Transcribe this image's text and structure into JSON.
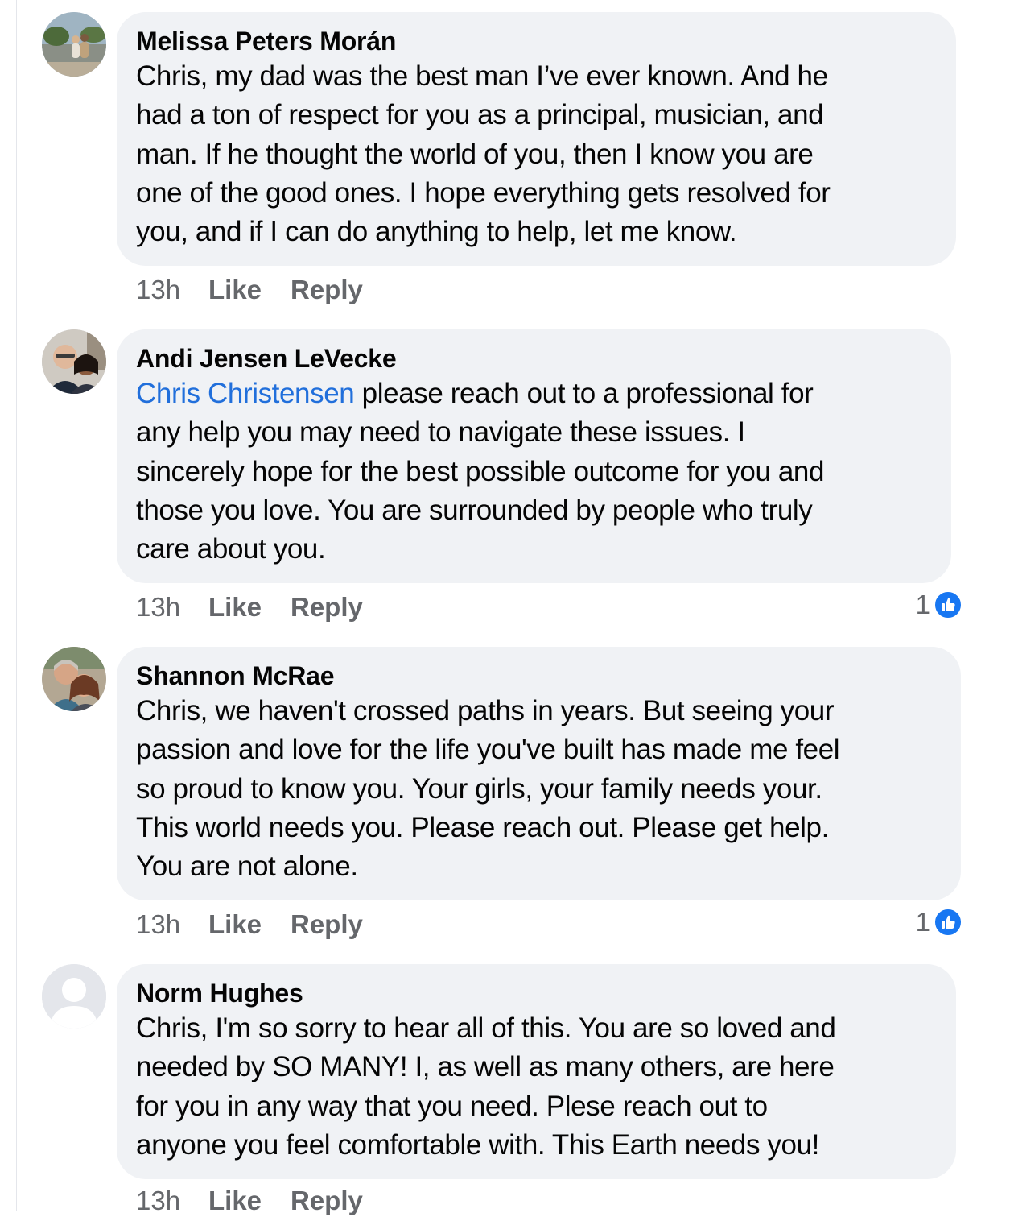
{
  "comments": [
    {
      "author": "Melissa Peters Morán",
      "mention": "",
      "text": "Chris, my dad was the best man I’ve ever known. And he\nhad a ton of respect for you as a principal, musician, and\nman. If he thought the world of you, then I know you are\none of the good ones. I hope everything gets resolved for\nyou, and if I can do anything to help, let me know.",
      "time": "13h",
      "like_label": "Like",
      "reply_label": "Reply",
      "reaction_count": ""
    },
    {
      "author": "Andi Jensen LeVecke",
      "mention": "Chris Christensen",
      "text": " please reach out to a professional for\nany help you may need to navigate these issues. I\nsincerely hope for the best possible outcome for you and\nthose you love. You are surrounded by people who truly\ncare about you.",
      "time": "13h",
      "like_label": "Like",
      "reply_label": "Reply",
      "reaction_count": "1"
    },
    {
      "author": "Shannon McRae",
      "mention": "",
      "text": "Chris, we haven't crossed paths in years. But seeing your\npassion and love for the life you've built has made me feel\nso proud to know you. Your girls, your family needs your.\nThis world needs you. Please reach out. Please get help.\nYou are not alone.",
      "time": "13h",
      "like_label": "Like",
      "reply_label": "Reply",
      "reaction_count": "1"
    },
    {
      "author": "Norm Hughes",
      "mention": "",
      "text": "Chris, I'm so sorry to hear all of this. You are so loved and\nneeded by SO MANY!  I, as well as  many others, are here\nfor you in any way that you need. Plese reach out to\nanyone you feel comfortable  with. This Earth needs you!",
      "time": "13h",
      "like_label": "Like",
      "reply_label": "Reply",
      "reaction_count": ""
    }
  ]
}
